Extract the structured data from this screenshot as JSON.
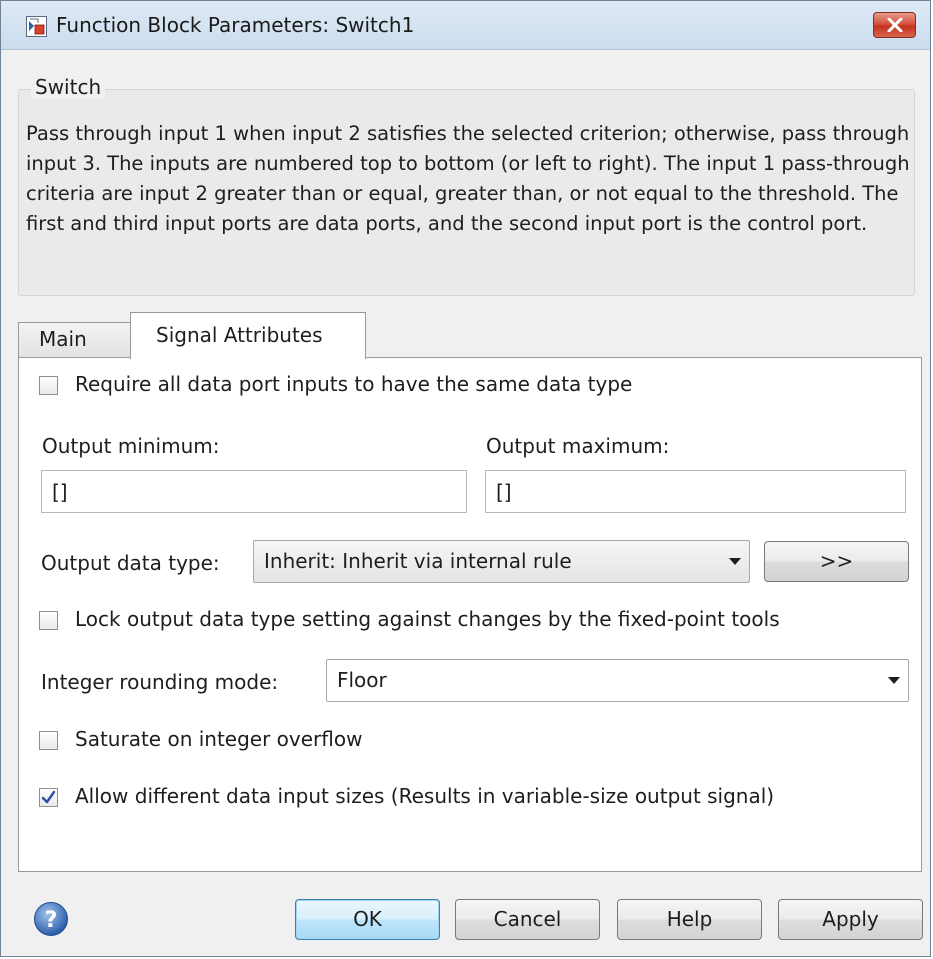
{
  "window": {
    "title": "Function Block Parameters: Switch1"
  },
  "block": {
    "name": "Switch",
    "description": "Pass through input 1 when input 2 satisfies the selected criterion; otherwise, pass through input 3.  The inputs are numbered top to bottom (or left to right). The input 1 pass-through criteria are input 2 greater than or equal, greater than, or not equal to the threshold.  The first and third input ports are data ports, and the second input port is the control port."
  },
  "tabs": [
    {
      "label": "Main",
      "selected": false
    },
    {
      "label": "Signal Attributes",
      "selected": true
    }
  ],
  "signal_attributes": {
    "require_same_type": {
      "label": "Require all data port inputs to have the same data type",
      "checked": false
    },
    "output_minimum": {
      "label": "Output minimum:",
      "value": "[]"
    },
    "output_maximum": {
      "label": "Output maximum:",
      "value": "[]"
    },
    "output_data_type": {
      "label": "Output data type:",
      "value": "Inherit: Inherit via internal rule",
      "assistant_label": ">>"
    },
    "lock_output_type": {
      "label": "Lock output data type setting against changes by the fixed-point tools",
      "checked": false
    },
    "rounding_mode": {
      "label": "Integer rounding mode:",
      "value": "Floor"
    },
    "saturate": {
      "label": "Saturate on integer overflow",
      "checked": false
    },
    "allow_different_sizes": {
      "label": "Allow different data input sizes (Results in variable-size output signal)",
      "checked": true
    }
  },
  "buttons": {
    "ok": "OK",
    "cancel": "Cancel",
    "help": "Help",
    "apply": "Apply"
  },
  "icons": {
    "window": "simulink-block-icon",
    "close": "close-icon",
    "help": "question-mark-icon",
    "dropdown": "chevron-down-icon",
    "check": "checkmark-icon"
  },
  "colors": {
    "close_button": "#c4331e",
    "default_button": "#bee6fd",
    "help_icon": "#3a6fb5",
    "checkmark": "#2a4fa0"
  }
}
